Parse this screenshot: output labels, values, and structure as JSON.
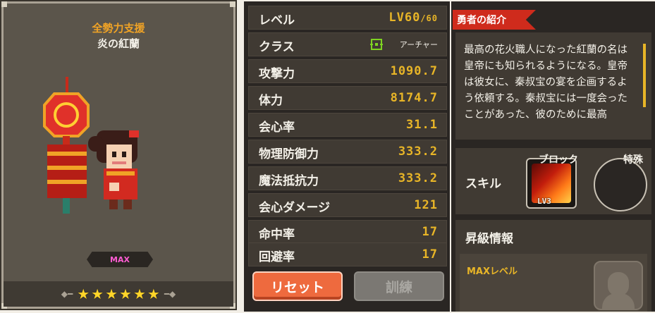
{
  "character": {
    "title": "全勢力支援",
    "name": "炎の紅蘭",
    "max_badge": "MAX",
    "stars": [
      "★",
      "★",
      "★",
      "★",
      "★",
      "★"
    ],
    "star_count": 6
  },
  "stats": [
    {
      "label": "レベル",
      "value": "LV60",
      "suffix": "/60"
    },
    {
      "label": "クラス",
      "value": "アーチャー",
      "icon": "crosshair-icon"
    },
    {
      "label": "攻撃力",
      "value": "1090.7"
    },
    {
      "label": "体力",
      "value": "8174.7"
    },
    {
      "label": "会心率",
      "value": "31.1"
    },
    {
      "label": "物理防御力",
      "value": "333.2"
    },
    {
      "label": "魔法抵抗力",
      "value": "333.2"
    },
    {
      "label": "会心ダメージ",
      "value": "121"
    },
    {
      "label": "命中率",
      "value": "17"
    },
    {
      "label": "回避率",
      "value": "17"
    }
  ],
  "buttons": {
    "reset": "リセット",
    "train": "訓練"
  },
  "info": {
    "tag": "勇者の紹介",
    "description": "最高の花火職人になった紅蘭の名は皇帝にも知られるようになる。皇帝は彼女に、秦叔宝の宴を企画するよう依頼する。秦叔宝には一度会ったことがあった、彼のために最高",
    "skill_label": "スキル",
    "skill1_caption": "ブロック",
    "skill1_level": "LV3",
    "skill2_caption": "特殊",
    "promo_title": "昇級情報",
    "promo_label": "MAXレベル"
  },
  "colors": {
    "accent_gold": "#e8b527",
    "title_orange": "#f0a326",
    "reset_button": "#ee6a3e",
    "tag_red": "#cf2b1c"
  }
}
